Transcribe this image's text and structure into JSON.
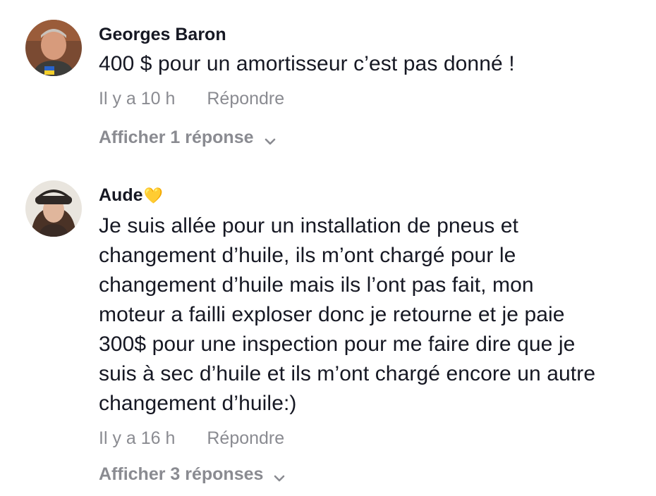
{
  "comments": [
    {
      "author": "Georges Baron",
      "author_emoji": "",
      "lines": [
        "400 $ pour un amortisseur c’est pas donné !"
      ],
      "time": "Il y a 10 h",
      "reply_label": "Répondre",
      "replies_label": "Afficher 1 réponse",
      "avatar_icon": "user-photo-man"
    },
    {
      "author": "Aude",
      "author_emoji": "💛",
      "lines": [
        "Je suis allée pour un installation de pneus et",
        "changement d’huile, ils m’ont chargé pour le",
        "changement d’huile mais ils l’ont pas fait, mon",
        "moteur a failli exploser donc je retourne et je paie",
        "300$ pour une inspection pour me faire dire que je",
        "suis à sec d’huile et ils m’ont chargé encore un autre",
        "changement d’huile:)"
      ],
      "time": "Il y a 16 h",
      "reply_label": "Répondre",
      "replies_label": "Afficher 3 réponses",
      "avatar_icon": "user-photo-woman"
    }
  ]
}
